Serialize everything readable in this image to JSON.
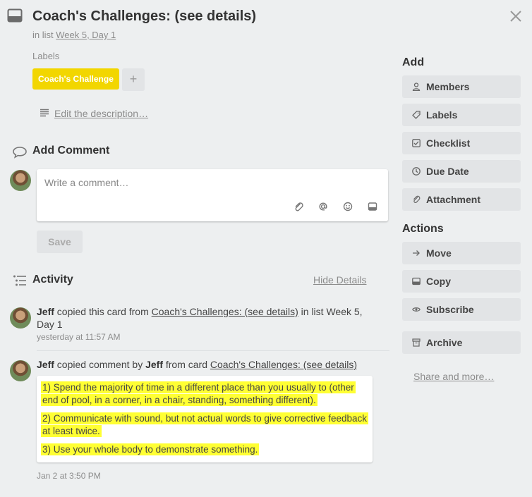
{
  "card": {
    "title": "Coach's Challenges: (see details)",
    "in_list_prefix": "in list ",
    "list_name": "Week 5, Day 1",
    "labels_heading": "Labels",
    "label": {
      "text": "Coach's Challenge",
      "color": "#f2d600"
    },
    "add_label": "+",
    "edit_description": "Edit the description…"
  },
  "comment": {
    "heading": "Add Comment",
    "placeholder": "Write a comment…",
    "save": "Save",
    "toolbar_icons": [
      "attachment-icon",
      "mention-icon",
      "emoji-icon",
      "card-icon"
    ]
  },
  "activity": {
    "heading": "Activity",
    "hide_details": "Hide Details",
    "items": [
      {
        "user": "Jeff",
        "action": " copied this card from ",
        "link": "Coach's Challenges: (see details)",
        "after_link": " in list Week 5, Day 1",
        "time": "yesterday at 11:57 AM"
      },
      {
        "user": "Jeff",
        "action": " copied comment by ",
        "user2": "Jeff",
        "action2": " from card ",
        "link": "Coach's Challenges: (see details)",
        "quote": [
          "1) Spend the majority of time in a different place than you usually to (other end of pool, in a corner, in a chair, standing, something different).",
          "2) Communicate with sound, but not actual words to give corrective feedback at least twice.",
          "3) Use your whole body to demonstrate something."
        ],
        "highlight_color": "#ffff33",
        "time": "Jan 2 at 3:50 PM"
      }
    ]
  },
  "sidebar": {
    "add_heading": "Add",
    "add_items": [
      {
        "label": "Members",
        "icon": "person-icon"
      },
      {
        "label": "Labels",
        "icon": "tag-icon"
      },
      {
        "label": "Checklist",
        "icon": "checkbox-icon"
      },
      {
        "label": "Due Date",
        "icon": "clock-icon"
      },
      {
        "label": "Attachment",
        "icon": "paperclip-icon"
      }
    ],
    "actions_heading": "Actions",
    "action_items": [
      {
        "label": "Move",
        "icon": "arrow-right-icon"
      },
      {
        "label": "Copy",
        "icon": "copy-icon"
      },
      {
        "label": "Subscribe",
        "icon": "eye-icon"
      },
      {
        "label": "Archive",
        "icon": "archive-icon"
      }
    ],
    "share": "Share and more…"
  }
}
